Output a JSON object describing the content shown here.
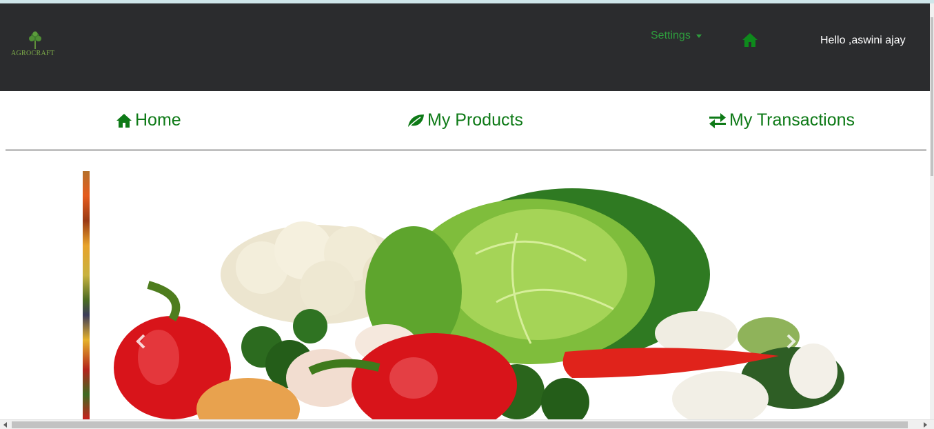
{
  "brand": {
    "name": "AGROCRAFT",
    "icon": "tree-icon"
  },
  "navbar": {
    "settings_label": "Settings",
    "home_icon": "home-icon",
    "greeting": "Hello ,aswini ajay"
  },
  "subnav": {
    "items": [
      {
        "label": "Home",
        "icon": "home-icon"
      },
      {
        "label": "My Products",
        "icon": "leaf-icon"
      },
      {
        "label": "My Transactions",
        "icon": "exchange-icon"
      }
    ]
  },
  "carousel": {
    "slide_subject": "vegetables",
    "controls": [
      "chevron-left-icon",
      "chevron-right-icon"
    ]
  },
  "colors": {
    "navbar_bg": "#2b2c2e",
    "accent_green": "#0e7a17",
    "settings_green": "#2e9c3d"
  }
}
